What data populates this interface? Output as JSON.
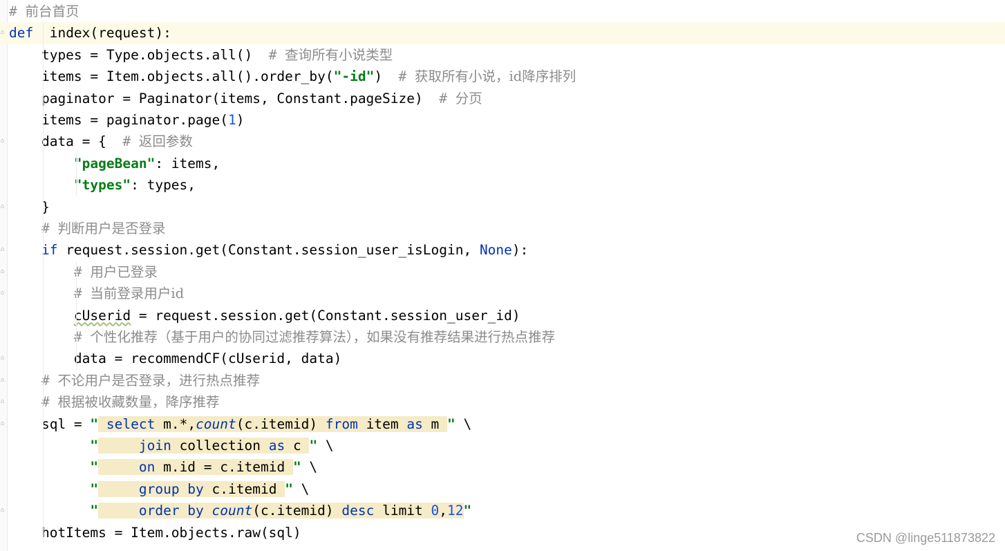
{
  "editor": {
    "lines": [
      {
        "id": "l1",
        "tokens": [
          [
            "cm-hash",
            "# "
          ],
          [
            "cm",
            "前台首页"
          ]
        ]
      },
      {
        "id": "l2",
        "tokens": [
          [
            "kw",
            "def"
          ],
          [
            "",
            "  index(request):"
          ]
        ]
      },
      {
        "id": "l3",
        "tokens": [
          [
            "",
            "    types = Type.objects.all()  "
          ],
          [
            "cm-hash",
            "# "
          ],
          [
            "cm",
            "查询所有小说类型"
          ]
        ]
      },
      {
        "id": "l4",
        "tokens": [
          [
            "",
            "    items = Item.objects.all().order_by("
          ],
          [
            "str",
            "\"-id\""
          ],
          [
            "",
            ")  "
          ],
          [
            "cm-hash",
            "# "
          ],
          [
            "cm",
            "获取所有小说，id降序排列"
          ]
        ]
      },
      {
        "id": "l5",
        "tokens": [
          [
            "",
            "    paginator = Paginator(items, Constant.pageSize)  "
          ],
          [
            "cm-hash",
            "# "
          ],
          [
            "cm",
            "分页"
          ]
        ]
      },
      {
        "id": "l6",
        "tokens": [
          [
            "",
            "    items = paginator.page("
          ],
          [
            "num",
            "1"
          ],
          [
            "",
            ")"
          ]
        ]
      },
      {
        "id": "l7",
        "tokens": [
          [
            "",
            "    data = {  "
          ],
          [
            "cm-hash",
            "# "
          ],
          [
            "cm",
            "返回参数"
          ]
        ]
      },
      {
        "id": "l8",
        "tokens": [
          [
            "",
            "        "
          ],
          [
            "str",
            "\"pageBean\""
          ],
          [
            "",
            ": items,"
          ]
        ]
      },
      {
        "id": "l9",
        "tokens": [
          [
            "",
            "        "
          ],
          [
            "str",
            "\"types\""
          ],
          [
            "",
            ": types,"
          ]
        ]
      },
      {
        "id": "l10",
        "tokens": [
          [
            "",
            "    }"
          ]
        ]
      },
      {
        "id": "l11",
        "tokens": [
          [
            "",
            "    "
          ],
          [
            "cm-hash",
            "# "
          ],
          [
            "cm",
            "判断用户是否登录"
          ]
        ]
      },
      {
        "id": "l12",
        "tokens": [
          [
            "",
            "    "
          ],
          [
            "kw",
            "if"
          ],
          [
            "",
            " request.session.get(Constant.session_user_isLogin, "
          ],
          [
            "kw",
            "None"
          ],
          [
            "",
            "):"
          ]
        ]
      },
      {
        "id": "l13",
        "tokens": [
          [
            "",
            "        "
          ],
          [
            "cm-hash",
            "# "
          ],
          [
            "cm",
            "用户已登录"
          ]
        ]
      },
      {
        "id": "l14",
        "tokens": [
          [
            "",
            "        "
          ],
          [
            "cm-hash",
            "# "
          ],
          [
            "cm",
            "当前登录用户id"
          ]
        ]
      },
      {
        "id": "l15",
        "tokens": [
          [
            "",
            "        "
          ],
          [
            "squig",
            "cUserid"
          ],
          [
            "",
            " = request.session.get(Constant.session_user_id)"
          ]
        ]
      },
      {
        "id": "l16",
        "tokens": [
          [
            "",
            "        "
          ],
          [
            "cm-hash",
            "# "
          ],
          [
            "cm",
            "个性化推荐（基于用户的协同过滤推荐算法），如果没有推荐结果进行热点推荐"
          ]
        ]
      },
      {
        "id": "l17",
        "tokens": [
          [
            "",
            "        data = recommendCF(cUserid, data)"
          ]
        ]
      },
      {
        "id": "l18",
        "tokens": [
          [
            "",
            "    "
          ],
          [
            "cm-hash",
            "# "
          ],
          [
            "cm",
            "不论用户是否登录，进行热点推荐"
          ]
        ]
      },
      {
        "id": "l19",
        "tokens": [
          [
            "",
            "    "
          ],
          [
            "cm-hash",
            "# "
          ],
          [
            "cm",
            "根据被收藏数量，降序推荐"
          ]
        ]
      },
      {
        "id": "l20",
        "tokens": [
          [
            "",
            "    sql = "
          ],
          [
            "str",
            "\""
          ],
          [
            "sqlhl",
            " "
          ],
          [
            "sqlhl kw",
            "select"
          ],
          [
            "sqlhl",
            " m.*,"
          ],
          [
            "sqlhl fn-it",
            "count"
          ],
          [
            "sqlhl",
            "(c.itemid) "
          ],
          [
            "sqlhl kw",
            "from"
          ],
          [
            "sqlhl",
            " item "
          ],
          [
            "sqlhl kw",
            "as"
          ],
          [
            "sqlhl",
            " m "
          ],
          [
            "str",
            "\""
          ],
          [
            "",
            " \\"
          ]
        ]
      },
      {
        "id": "l21",
        "tokens": [
          [
            "",
            "          "
          ],
          [
            "str",
            "\""
          ],
          [
            "sqlhl",
            "     "
          ],
          [
            "sqlhl kw",
            "join"
          ],
          [
            "sqlhl",
            " collection "
          ],
          [
            "sqlhl kw",
            "as"
          ],
          [
            "sqlhl",
            " c "
          ],
          [
            "str",
            "\""
          ],
          [
            "",
            " \\"
          ]
        ]
      },
      {
        "id": "l22",
        "tokens": [
          [
            "",
            "          "
          ],
          [
            "str",
            "\""
          ],
          [
            "sqlhl",
            "     "
          ],
          [
            "sqlhl kw",
            "on"
          ],
          [
            "sqlhl",
            " m.id = c.itemid "
          ],
          [
            "str",
            "\""
          ],
          [
            "",
            " \\"
          ]
        ]
      },
      {
        "id": "l23",
        "tokens": [
          [
            "",
            "          "
          ],
          [
            "str",
            "\""
          ],
          [
            "sqlhl",
            "     "
          ],
          [
            "sqlhl kw",
            "group by"
          ],
          [
            "sqlhl",
            " c.itemid "
          ],
          [
            "str",
            "\""
          ],
          [
            "",
            " \\"
          ]
        ]
      },
      {
        "id": "l24",
        "tokens": [
          [
            "",
            "          "
          ],
          [
            "str",
            "\""
          ],
          [
            "sqlhl",
            "     "
          ],
          [
            "sqlhl kw",
            "order by"
          ],
          [
            "sqlhl",
            " "
          ],
          [
            "sqlhl fn-it",
            "count"
          ],
          [
            "sqlhl",
            "(c.itemid) "
          ],
          [
            "sqlhl kw",
            "desc"
          ],
          [
            "sqlhl",
            " limit "
          ],
          [
            "sqlhl num",
            "0"
          ],
          [
            "sqlhl",
            ","
          ],
          [
            "sqlhl num",
            "12"
          ],
          [
            "str",
            "\""
          ]
        ]
      },
      {
        "id": "l25",
        "tokens": [
          [
            "",
            "    hotItems = Item.objects.raw(sql)"
          ]
        ]
      }
    ],
    "current_line": 1
  },
  "watermark": "CSDN @linge511873822",
  "colors": {
    "keyword": "#0033b3",
    "string": "#067d17",
    "number": "#1750eb",
    "comment": "#8c8c8c",
    "sql_highlight": "#f5ebc6"
  }
}
